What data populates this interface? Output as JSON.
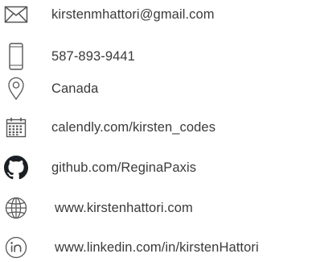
{
  "contacts": {
    "items": [
      {
        "icon": "envelope-icon",
        "text": "kirstenmhattori@gmail.com"
      },
      {
        "icon": "phone-icon",
        "text": "587-893-9441"
      },
      {
        "icon": "location-pin-icon",
        "text": "Canada"
      },
      {
        "icon": "calendar-icon",
        "text": "calendly.com/kirsten_codes"
      },
      {
        "icon": "github-icon",
        "text": "github.com/ReginaPaxis"
      },
      {
        "icon": "globe-icon",
        "text": "www.kirstenhattori.com"
      },
      {
        "icon": "linkedin-icon",
        "text": "www.linkedin.com/in/kirstenHattori"
      }
    ]
  },
  "colors": {
    "text": "#3a3a3a",
    "icon_stroke": "#555555",
    "github_fill": "#1b1f23"
  }
}
